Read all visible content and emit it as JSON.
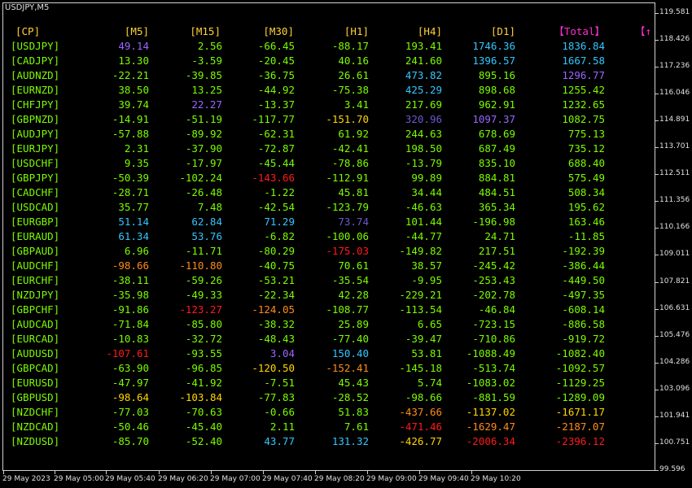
{
  "window": {
    "title": "USDJPY,M5"
  },
  "price_axis": [
    "119.581",
    "118.426",
    "117.236",
    "116.046",
    "114.891",
    "113.701",
    "112.511",
    "111.356",
    "110.166",
    "109.011",
    "107.821",
    "106.631",
    "105.476",
    "104.286",
    "103.096",
    "101.941",
    "100.751",
    "99.596"
  ],
  "time_axis": [
    "29 May 2023",
    "29 May 05:00",
    "29 May 05:40",
    "29 May 06:20",
    "29 May 07:00",
    "29 May 07:40",
    "29 May 08:20",
    "29 May 09:00",
    "29 May 09:40",
    "29 May 10:20"
  ],
  "colors": {
    "pair": "#7cfc00",
    "header": "#ffd23a",
    "total_header": "#ff2fd1",
    "green": "#7cfc00",
    "violet": "#9966ff",
    "skyblue": "#33c6ff",
    "yellow": "#ffd700",
    "orange": "#ff8c1a",
    "red": "#ff1a1a",
    "indigo": "#6a5acd"
  },
  "table": {
    "headers": [
      "[CP]",
      "[M5]",
      "[M15]",
      "[M30]",
      "[H1]",
      "[H4]",
      "[D1]",
      "[Total]"
    ],
    "arrow": "↑",
    "rows": [
      {
        "pair": "[USDJPY]",
        "values": [
          {
            "v": "49.14",
            "c": "violet"
          },
          {
            "v": "2.56",
            "c": "green"
          },
          {
            "v": "-66.45",
            "c": "green"
          },
          {
            "v": "-88.17",
            "c": "green"
          },
          {
            "v": "193.41",
            "c": "green"
          },
          {
            "v": "1746.36",
            "c": "skyblue"
          },
          {
            "v": "1836.84",
            "c": "skyblue"
          }
        ]
      },
      {
        "pair": "[CADJPY]",
        "values": [
          {
            "v": "13.30",
            "c": "green"
          },
          {
            "v": "-3.59",
            "c": "green"
          },
          {
            "v": "-20.45",
            "c": "green"
          },
          {
            "v": "40.16",
            "c": "green"
          },
          {
            "v": "241.60",
            "c": "green"
          },
          {
            "v": "1396.57",
            "c": "skyblue"
          },
          {
            "v": "1667.58",
            "c": "skyblue"
          }
        ]
      },
      {
        "pair": "[AUDNZD]",
        "values": [
          {
            "v": "-22.21",
            "c": "green"
          },
          {
            "v": "-39.85",
            "c": "green"
          },
          {
            "v": "-36.75",
            "c": "green"
          },
          {
            "v": "26.61",
            "c": "green"
          },
          {
            "v": "473.82",
            "c": "skyblue"
          },
          {
            "v": "895.16",
            "c": "green"
          },
          {
            "v": "1296.77",
            "c": "violet"
          }
        ]
      },
      {
        "pair": "[EURNZD]",
        "values": [
          {
            "v": "38.50",
            "c": "green"
          },
          {
            "v": "13.25",
            "c": "green"
          },
          {
            "v": "-44.92",
            "c": "green"
          },
          {
            "v": "-75.38",
            "c": "green"
          },
          {
            "v": "425.29",
            "c": "skyblue"
          },
          {
            "v": "898.68",
            "c": "green"
          },
          {
            "v": "1255.42",
            "c": "green"
          }
        ]
      },
      {
        "pair": "[CHFJPY]",
        "values": [
          {
            "v": "39.74",
            "c": "green"
          },
          {
            "v": "22.27",
            "c": "violet"
          },
          {
            "v": "-13.37",
            "c": "green"
          },
          {
            "v": "3.41",
            "c": "green"
          },
          {
            "v": "217.69",
            "c": "green"
          },
          {
            "v": "962.91",
            "c": "green"
          },
          {
            "v": "1232.65",
            "c": "green"
          }
        ]
      },
      {
        "pair": "[GBPNZD]",
        "values": [
          {
            "v": "-14.91",
            "c": "green"
          },
          {
            "v": "-51.19",
            "c": "green"
          },
          {
            "v": "-117.77",
            "c": "green"
          },
          {
            "v": "-151.70",
            "c": "yellow"
          },
          {
            "v": "320.96",
            "c": "indigo"
          },
          {
            "v": "1097.37",
            "c": "violet"
          },
          {
            "v": "1082.75",
            "c": "green"
          }
        ]
      },
      {
        "pair": "[AUDJPY]",
        "values": [
          {
            "v": "-57.88",
            "c": "green"
          },
          {
            "v": "-89.92",
            "c": "green"
          },
          {
            "v": "-62.31",
            "c": "green"
          },
          {
            "v": "61.92",
            "c": "green"
          },
          {
            "v": "244.63",
            "c": "green"
          },
          {
            "v": "678.69",
            "c": "green"
          },
          {
            "v": "775.13",
            "c": "green"
          }
        ]
      },
      {
        "pair": "[EURJPY]",
        "values": [
          {
            "v": "2.31",
            "c": "green"
          },
          {
            "v": "-37.90",
            "c": "green"
          },
          {
            "v": "-72.87",
            "c": "green"
          },
          {
            "v": "-42.41",
            "c": "green"
          },
          {
            "v": "198.50",
            "c": "green"
          },
          {
            "v": "687.49",
            "c": "green"
          },
          {
            "v": "735.12",
            "c": "green"
          }
        ]
      },
      {
        "pair": "[USDCHF]",
        "values": [
          {
            "v": "9.35",
            "c": "green"
          },
          {
            "v": "-17.97",
            "c": "green"
          },
          {
            "v": "-45.44",
            "c": "green"
          },
          {
            "v": "-78.86",
            "c": "green"
          },
          {
            "v": "-13.79",
            "c": "green"
          },
          {
            "v": "835.10",
            "c": "green"
          },
          {
            "v": "688.40",
            "c": "green"
          }
        ]
      },
      {
        "pair": "[GBPJPY]",
        "values": [
          {
            "v": "-50.39",
            "c": "green"
          },
          {
            "v": "-102.24",
            "c": "green"
          },
          {
            "v": "-143.66",
            "c": "red"
          },
          {
            "v": "-112.91",
            "c": "green"
          },
          {
            "v": "99.89",
            "c": "green"
          },
          {
            "v": "884.81",
            "c": "green"
          },
          {
            "v": "575.49",
            "c": "green"
          }
        ]
      },
      {
        "pair": "[CADCHF]",
        "values": [
          {
            "v": "-28.71",
            "c": "green"
          },
          {
            "v": "-26.48",
            "c": "green"
          },
          {
            "v": "-1.22",
            "c": "green"
          },
          {
            "v": "45.81",
            "c": "green"
          },
          {
            "v": "34.44",
            "c": "green"
          },
          {
            "v": "484.51",
            "c": "green"
          },
          {
            "v": "508.34",
            "c": "green"
          }
        ]
      },
      {
        "pair": "[USDCAD]",
        "values": [
          {
            "v": "35.77",
            "c": "green"
          },
          {
            "v": "7.48",
            "c": "green"
          },
          {
            "v": "-42.54",
            "c": "green"
          },
          {
            "v": "-123.79",
            "c": "green"
          },
          {
            "v": "-46.63",
            "c": "green"
          },
          {
            "v": "365.34",
            "c": "green"
          },
          {
            "v": "195.62",
            "c": "green"
          }
        ]
      },
      {
        "pair": "[EURGBP]",
        "values": [
          {
            "v": "51.14",
            "c": "skyblue"
          },
          {
            "v": "62.84",
            "c": "skyblue"
          },
          {
            "v": "71.29",
            "c": "skyblue"
          },
          {
            "v": "73.74",
            "c": "indigo"
          },
          {
            "v": "101.44",
            "c": "green"
          },
          {
            "v": "-196.98",
            "c": "green"
          },
          {
            "v": "163.46",
            "c": "green"
          }
        ]
      },
      {
        "pair": "[EURAUD]",
        "values": [
          {
            "v": "61.34",
            "c": "skyblue"
          },
          {
            "v": "53.76",
            "c": "skyblue"
          },
          {
            "v": "-6.82",
            "c": "green"
          },
          {
            "v": "-100.06",
            "c": "green"
          },
          {
            "v": "-44.77",
            "c": "green"
          },
          {
            "v": "24.71",
            "c": "green"
          },
          {
            "v": "-11.85",
            "c": "green"
          }
        ]
      },
      {
        "pair": "[GBPAUD]",
        "values": [
          {
            "v": "6.96",
            "c": "green"
          },
          {
            "v": "-11.71",
            "c": "green"
          },
          {
            "v": "-80.29",
            "c": "green"
          },
          {
            "v": "-175.03",
            "c": "red"
          },
          {
            "v": "-149.82",
            "c": "green"
          },
          {
            "v": "217.51",
            "c": "green"
          },
          {
            "v": "-192.39",
            "c": "green"
          }
        ]
      },
      {
        "pair": "[AUDCHF]",
        "values": [
          {
            "v": "-98.66",
            "c": "orange"
          },
          {
            "v": "-110.80",
            "c": "orange"
          },
          {
            "v": "-40.75",
            "c": "green"
          },
          {
            "v": "70.61",
            "c": "green"
          },
          {
            "v": "38.57",
            "c": "green"
          },
          {
            "v": "-245.42",
            "c": "green"
          },
          {
            "v": "-386.44",
            "c": "green"
          }
        ]
      },
      {
        "pair": "[EURCHF]",
        "values": [
          {
            "v": "-38.11",
            "c": "green"
          },
          {
            "v": "-59.26",
            "c": "green"
          },
          {
            "v": "-53.21",
            "c": "green"
          },
          {
            "v": "-35.54",
            "c": "green"
          },
          {
            "v": "-9.95",
            "c": "green"
          },
          {
            "v": "-253.43",
            "c": "green"
          },
          {
            "v": "-449.50",
            "c": "green"
          }
        ]
      },
      {
        "pair": "[NZDJPY]",
        "values": [
          {
            "v": "-35.98",
            "c": "green"
          },
          {
            "v": "-49.33",
            "c": "green"
          },
          {
            "v": "-22.34",
            "c": "green"
          },
          {
            "v": "42.28",
            "c": "green"
          },
          {
            "v": "-229.21",
            "c": "green"
          },
          {
            "v": "-202.78",
            "c": "green"
          },
          {
            "v": "-497.35",
            "c": "green"
          }
        ]
      },
      {
        "pair": "[GBPCHF]",
        "values": [
          {
            "v": "-91.86",
            "c": "green"
          },
          {
            "v": "-123.27",
            "c": "red"
          },
          {
            "v": "-124.05",
            "c": "orange"
          },
          {
            "v": "-108.77",
            "c": "green"
          },
          {
            "v": "-113.54",
            "c": "green"
          },
          {
            "v": "-46.84",
            "c": "green"
          },
          {
            "v": "-608.14",
            "c": "green"
          }
        ]
      },
      {
        "pair": "[AUDCAD]",
        "values": [
          {
            "v": "-71.84",
            "c": "green"
          },
          {
            "v": "-85.80",
            "c": "green"
          },
          {
            "v": "-38.32",
            "c": "green"
          },
          {
            "v": "25.89",
            "c": "green"
          },
          {
            "v": "6.65",
            "c": "green"
          },
          {
            "v": "-723.15",
            "c": "green"
          },
          {
            "v": "-886.58",
            "c": "green"
          }
        ]
      },
      {
        "pair": "[EURCAD]",
        "values": [
          {
            "v": "-10.83",
            "c": "green"
          },
          {
            "v": "-32.72",
            "c": "green"
          },
          {
            "v": "-48.43",
            "c": "green"
          },
          {
            "v": "-77.40",
            "c": "green"
          },
          {
            "v": "-39.47",
            "c": "green"
          },
          {
            "v": "-710.86",
            "c": "green"
          },
          {
            "v": "-919.72",
            "c": "green"
          }
        ]
      },
      {
        "pair": "[AUDUSD]",
        "values": [
          {
            "v": "-107.61",
            "c": "red"
          },
          {
            "v": "-93.55",
            "c": "green"
          },
          {
            "v": "3.04",
            "c": "violet"
          },
          {
            "v": "150.40",
            "c": "skyblue"
          },
          {
            "v": "53.81",
            "c": "green"
          },
          {
            "v": "-1088.49",
            "c": "green"
          },
          {
            "v": "-1082.40",
            "c": "green"
          }
        ]
      },
      {
        "pair": "[GBPCAD]",
        "values": [
          {
            "v": "-63.90",
            "c": "green"
          },
          {
            "v": "-96.85",
            "c": "green"
          },
          {
            "v": "-120.50",
            "c": "yellow"
          },
          {
            "v": "-152.41",
            "c": "orange"
          },
          {
            "v": "-145.18",
            "c": "green"
          },
          {
            "v": "-513.74",
            "c": "green"
          },
          {
            "v": "-1092.57",
            "c": "green"
          }
        ]
      },
      {
        "pair": "[EURUSD]",
        "values": [
          {
            "v": "-47.97",
            "c": "green"
          },
          {
            "v": "-41.92",
            "c": "green"
          },
          {
            "v": "-7.51",
            "c": "green"
          },
          {
            "v": "45.43",
            "c": "green"
          },
          {
            "v": "5.74",
            "c": "green"
          },
          {
            "v": "-1083.02",
            "c": "green"
          },
          {
            "v": "-1129.25",
            "c": "green"
          }
        ]
      },
      {
        "pair": "[GBPUSD]",
        "values": [
          {
            "v": "-98.64",
            "c": "yellow"
          },
          {
            "v": "-103.84",
            "c": "yellow"
          },
          {
            "v": "-77.83",
            "c": "green"
          },
          {
            "v": "-28.52",
            "c": "green"
          },
          {
            "v": "-98.66",
            "c": "green"
          },
          {
            "v": "-881.59",
            "c": "green"
          },
          {
            "v": "-1289.09",
            "c": "green"
          }
        ]
      },
      {
        "pair": "[NZDCHF]",
        "values": [
          {
            "v": "-77.03",
            "c": "green"
          },
          {
            "v": "-70.63",
            "c": "green"
          },
          {
            "v": "-0.66",
            "c": "green"
          },
          {
            "v": "51.83",
            "c": "green"
          },
          {
            "v": "-437.66",
            "c": "orange"
          },
          {
            "v": "-1137.02",
            "c": "yellow"
          },
          {
            "v": "-1671.17",
            "c": "yellow"
          }
        ]
      },
      {
        "pair": "[NZDCAD]",
        "values": [
          {
            "v": "-50.46",
            "c": "green"
          },
          {
            "v": "-45.40",
            "c": "green"
          },
          {
            "v": "2.11",
            "c": "green"
          },
          {
            "v": "7.61",
            "c": "green"
          },
          {
            "v": "-471.46",
            "c": "red"
          },
          {
            "v": "-1629.47",
            "c": "orange"
          },
          {
            "v": "-2187.07",
            "c": "orange"
          }
        ]
      },
      {
        "pair": "[NZDUSD]",
        "values": [
          {
            "v": "-85.70",
            "c": "green"
          },
          {
            "v": "-52.40",
            "c": "green"
          },
          {
            "v": "43.77",
            "c": "skyblue"
          },
          {
            "v": "131.32",
            "c": "skyblue"
          },
          {
            "v": "-426.77",
            "c": "yellow"
          },
          {
            "v": "-2006.34",
            "c": "red"
          },
          {
            "v": "-2396.12",
            "c": "red"
          }
        ]
      }
    ]
  }
}
